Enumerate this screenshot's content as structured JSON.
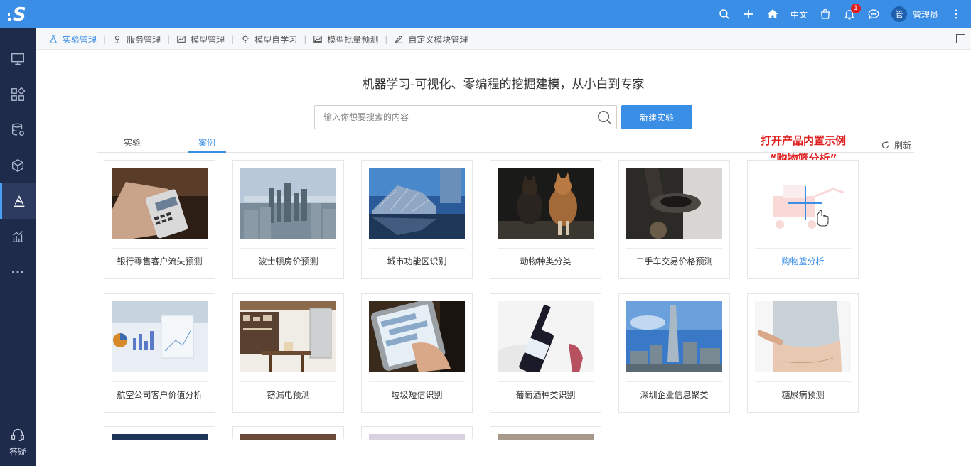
{
  "app": {
    "help_label": "答疑"
  },
  "topbar": {
    "lang": "中文",
    "notif_count": "1",
    "avatar_text": "管",
    "user_name": "管理员"
  },
  "modules": [
    {
      "label": "实验管理",
      "icon": "flask-icon"
    },
    {
      "label": "服务管理",
      "icon": "map-pin-icon"
    },
    {
      "label": "模型管理",
      "icon": "line-chart-icon"
    },
    {
      "label": "模型自学习",
      "icon": "lightbulb-icon"
    },
    {
      "label": "模型批量预测",
      "icon": "area-chart-icon"
    },
    {
      "label": "自定义模块管理",
      "icon": "pencil-icon"
    }
  ],
  "main": {
    "headline": "机器学习-可视化、零编程的挖掘建模，从小白到专家",
    "search_placeholder": "输入你想要搜索的内容",
    "new_button": "新建实验",
    "tabs": [
      "实验",
      "案例"
    ],
    "refresh": "刷新",
    "annotation_line1": "打开产品内置示例",
    "annotation_line2": "“购物篮分析”"
  },
  "cases": [
    "银行零售客户流失预测",
    "波士顿房价预测",
    "城市功能区识别",
    "动物种类分类",
    "二手车交易价格预测",
    "购物篮分析",
    "航空公司客户价值分析",
    "窃漏电预测",
    "垃圾短信识别",
    "葡萄酒种类识别",
    "深圳企业信息聚类",
    "糖尿病预测"
  ],
  "colors": {
    "accent": "#3a8ee6",
    "sidebar": "#1e2b4a",
    "annotation": "#e02020"
  }
}
